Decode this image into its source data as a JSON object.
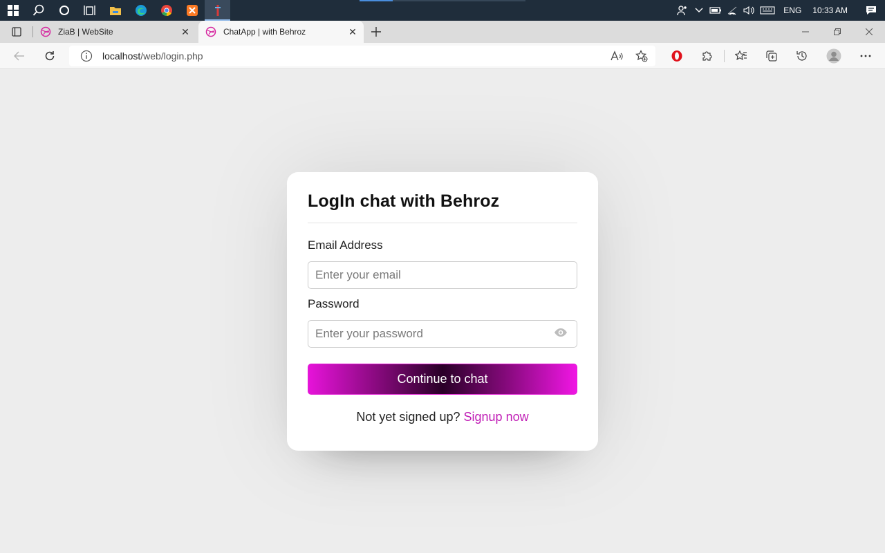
{
  "taskbar": {
    "apps": [
      "windows-start-icon",
      "search-icon",
      "cortana-icon",
      "task-view-icon",
      "file-explorer-icon",
      "edge-icon",
      "chrome-icon",
      "xampp-icon",
      "app-active-icon"
    ],
    "tray": {
      "language": "ENG",
      "time": "10:33 AM"
    }
  },
  "browser": {
    "tabs": [
      {
        "title": "ZiaB | WebSite",
        "active": false
      },
      {
        "title": "ChatApp | with Behroz",
        "active": true
      }
    ],
    "address": {
      "host": "localhost",
      "path": "/web/login.php"
    }
  },
  "login": {
    "title": "LogIn chat with Behroz",
    "email_label": "Email Address",
    "email_placeholder": "Enter your email",
    "password_label": "Password",
    "password_placeholder": "Enter your password",
    "submit_label": "Continue to chat",
    "signup_prompt": "Not yet signed up?",
    "signup_link": "Signup now"
  },
  "colors": {
    "accent": "#c01bb5",
    "button_edge": "#e613d9",
    "button_center": "#2a0028",
    "page_bg": "#ededed"
  }
}
